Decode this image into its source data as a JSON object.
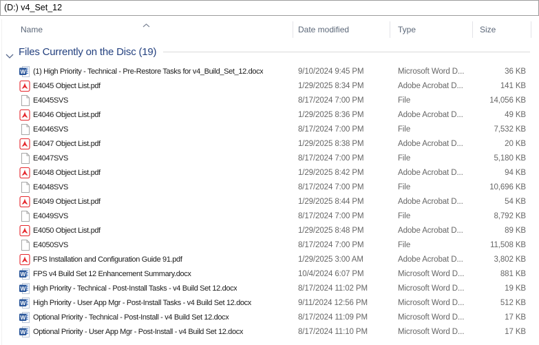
{
  "window": {
    "title": "(D:) v4_Set_12"
  },
  "columns": {
    "name": {
      "label": "Name"
    },
    "date": {
      "label": "Date modified"
    },
    "type": {
      "label": "Type"
    },
    "size": {
      "label": "Size"
    },
    "sort": {
      "column": "Name",
      "direction": "ascending"
    }
  },
  "group": {
    "label": "Files Currently on the Disc (19)",
    "expanded": true,
    "count": 19
  },
  "files": [
    {
      "icon": "word",
      "name": "(1) High Priority - Technical - Pre-Restore Tasks for v4_Build_Set_12.docx",
      "date_modified": "9/10/2024 9:45 PM",
      "type": "Microsoft Word D...",
      "size": "36 KB"
    },
    {
      "icon": "pdf",
      "name": "E4045 Object List.pdf",
      "date_modified": "1/29/2025 8:34 PM",
      "type": "Adobe Acrobat D...",
      "size": "141 KB"
    },
    {
      "icon": "file",
      "name": "E4045SVS",
      "date_modified": "8/17/2024 7:00 PM",
      "type": "File",
      "size": "14,056 KB"
    },
    {
      "icon": "pdf",
      "name": "E4046 Object List.pdf",
      "date_modified": "1/29/2025 8:36 PM",
      "type": "Adobe Acrobat D...",
      "size": "49 KB"
    },
    {
      "icon": "file",
      "name": "E4046SVS",
      "date_modified": "8/17/2024 7:00 PM",
      "type": "File",
      "size": "7,532 KB"
    },
    {
      "icon": "pdf",
      "name": "E4047 Object List.pdf",
      "date_modified": "1/29/2025 8:38 PM",
      "type": "Adobe Acrobat D...",
      "size": "20 KB"
    },
    {
      "icon": "file",
      "name": "E4047SVS",
      "date_modified": "8/17/2024 7:00 PM",
      "type": "File",
      "size": "5,180 KB"
    },
    {
      "icon": "pdf",
      "name": "E4048 Object List.pdf",
      "date_modified": "1/29/2025 8:42 PM",
      "type": "Adobe Acrobat D...",
      "size": "94 KB"
    },
    {
      "icon": "file",
      "name": "E4048SVS",
      "date_modified": "8/17/2024 7:00 PM",
      "type": "File",
      "size": "10,696 KB"
    },
    {
      "icon": "pdf",
      "name": "E4049 Object List.pdf",
      "date_modified": "1/29/2025 8:44 PM",
      "type": "Adobe Acrobat D...",
      "size": "54 KB"
    },
    {
      "icon": "file",
      "name": "E4049SVS",
      "date_modified": "8/17/2024 7:00 PM",
      "type": "File",
      "size": "8,792 KB"
    },
    {
      "icon": "pdf",
      "name": "E4050 Object List.pdf",
      "date_modified": "1/29/2025 8:48 PM",
      "type": "Adobe Acrobat D...",
      "size": "89 KB"
    },
    {
      "icon": "file",
      "name": "E4050SVS",
      "date_modified": "8/17/2024 7:00 PM",
      "type": "File",
      "size": "11,508 KB"
    },
    {
      "icon": "pdf",
      "name": "FPS Installation and Configuration Guide 91.pdf",
      "date_modified": "1/29/2025 3:00 AM",
      "type": "Adobe Acrobat D...",
      "size": "3,802 KB"
    },
    {
      "icon": "word",
      "name": "FPS v4 Build Set 12 Enhancement Summary.docx",
      "date_modified": "10/4/2024 6:07 PM",
      "type": "Microsoft Word D...",
      "size": "881 KB"
    },
    {
      "icon": "word",
      "name": "High Priority - Technical - Post-Install Tasks - v4 Build Set 12.docx",
      "date_modified": "8/17/2024 11:02 PM",
      "type": "Microsoft Word D...",
      "size": "19 KB"
    },
    {
      "icon": "word",
      "name": "High Priority - User App Mgr - Post-Install Tasks - v4 Build Set 12.docx",
      "date_modified": "9/11/2024 12:56 PM",
      "type": "Microsoft Word D...",
      "size": "512 KB"
    },
    {
      "icon": "word",
      "name": "Optional Priority - Technical - Post-Install - v4 Build Set 12.docx",
      "date_modified": "8/17/2024 11:09 PM",
      "type": "Microsoft Word D...",
      "size": "17 KB"
    },
    {
      "icon": "word",
      "name": "Optional Priority - User App Mgr - Post-Install - v4 Build Set 12.docx",
      "date_modified": "8/17/2024 11:10 PM",
      "type": "Microsoft Word D...",
      "size": "17 KB"
    }
  ],
  "colors": {
    "group_header_blue": "#24417f",
    "column_header_gray_blue": "#5b6778",
    "secondary_text": "#666666",
    "word_icon_blue": "#2b579a",
    "pdf_icon_red": "#e5252a",
    "separator_gray": "#e3e3e8"
  }
}
